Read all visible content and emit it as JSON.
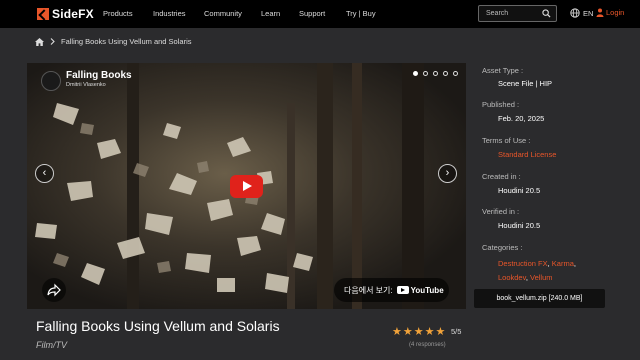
{
  "brand": {
    "logo_text": "SideFX",
    "accent": "#e8562a"
  },
  "nav": {
    "items": [
      "Products",
      "Industries",
      "Community",
      "Learn",
      "Support",
      "Try | Buy"
    ]
  },
  "search": {
    "placeholder": "Search"
  },
  "header": {
    "lang": "EN",
    "login": "Login"
  },
  "breadcrumb": {
    "current": "Falling Books Using Vellum and Solaris"
  },
  "video": {
    "title": "Falling Books",
    "author": "Dmitrii Vlasenko",
    "watch_on": "다음에서 보기:",
    "platform": "YouTube",
    "carousel_count": 5,
    "carousel_active": 0
  },
  "asset": {
    "title": "Falling Books Using Vellum and Solaris",
    "category": "Film/TV",
    "rating_value": 5,
    "rating_text": "5/5",
    "responses": "(4 responses)"
  },
  "sidebar": {
    "asset_type_label": "Asset Type :",
    "asset_type": "Scene File | HIP",
    "published_label": "Published :",
    "published": "Feb. 20, 2025",
    "terms_label": "Terms of Use :",
    "terms": "Standard License",
    "created_label": "Created in :",
    "created": "Houdini 20.5",
    "verified_label": "Verified in :",
    "verified": "Houdini 20.5",
    "categories_label": "Categories :",
    "categories": [
      "Destruction FX",
      "Karma",
      "Lookdev",
      "Vellum"
    ],
    "download": "book_vellum.zip [240.0 MB]"
  }
}
